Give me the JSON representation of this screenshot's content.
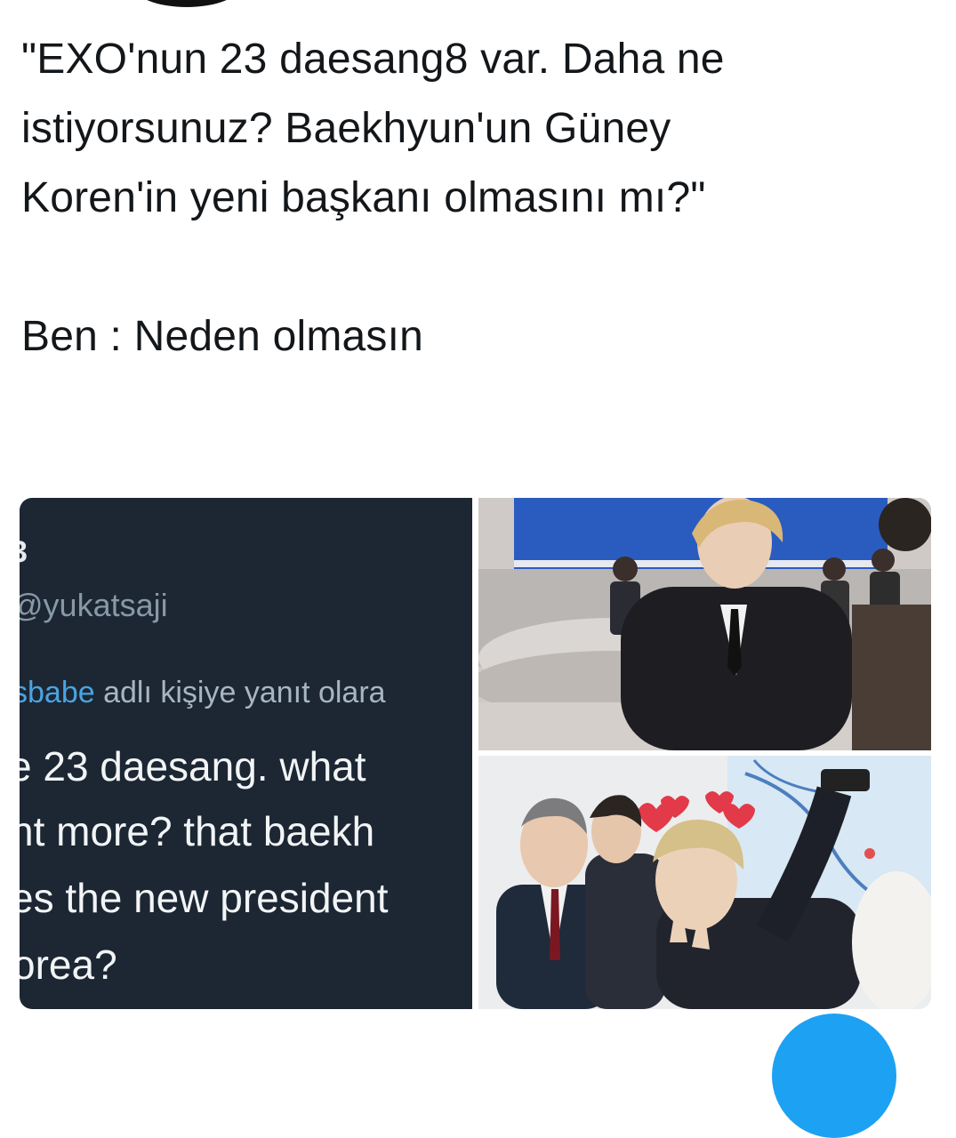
{
  "tweet": {
    "lines": [
      "\"EXO'nun 23 daesang8 var. Daha ne",
      "istiyorsunuz? Baekhyun'un Güney",
      "Koren'in yeni başkanı olmasını mı?\"",
      "Ben : Neden olmasın"
    ]
  },
  "media": {
    "screenshot": {
      "name_fragment": "3",
      "handle": "@yukatsaji",
      "reply_mention": "sbabe",
      "reply_text": " adlı kişiye yanıt olara",
      "quote_lines": [
        "e 23 daesang. what",
        "nt more? that baekh",
        "es the new president",
        "orea?"
      ]
    }
  },
  "colors": {
    "accent": "#1da1f2",
    "dark_card": "#1c2733"
  }
}
